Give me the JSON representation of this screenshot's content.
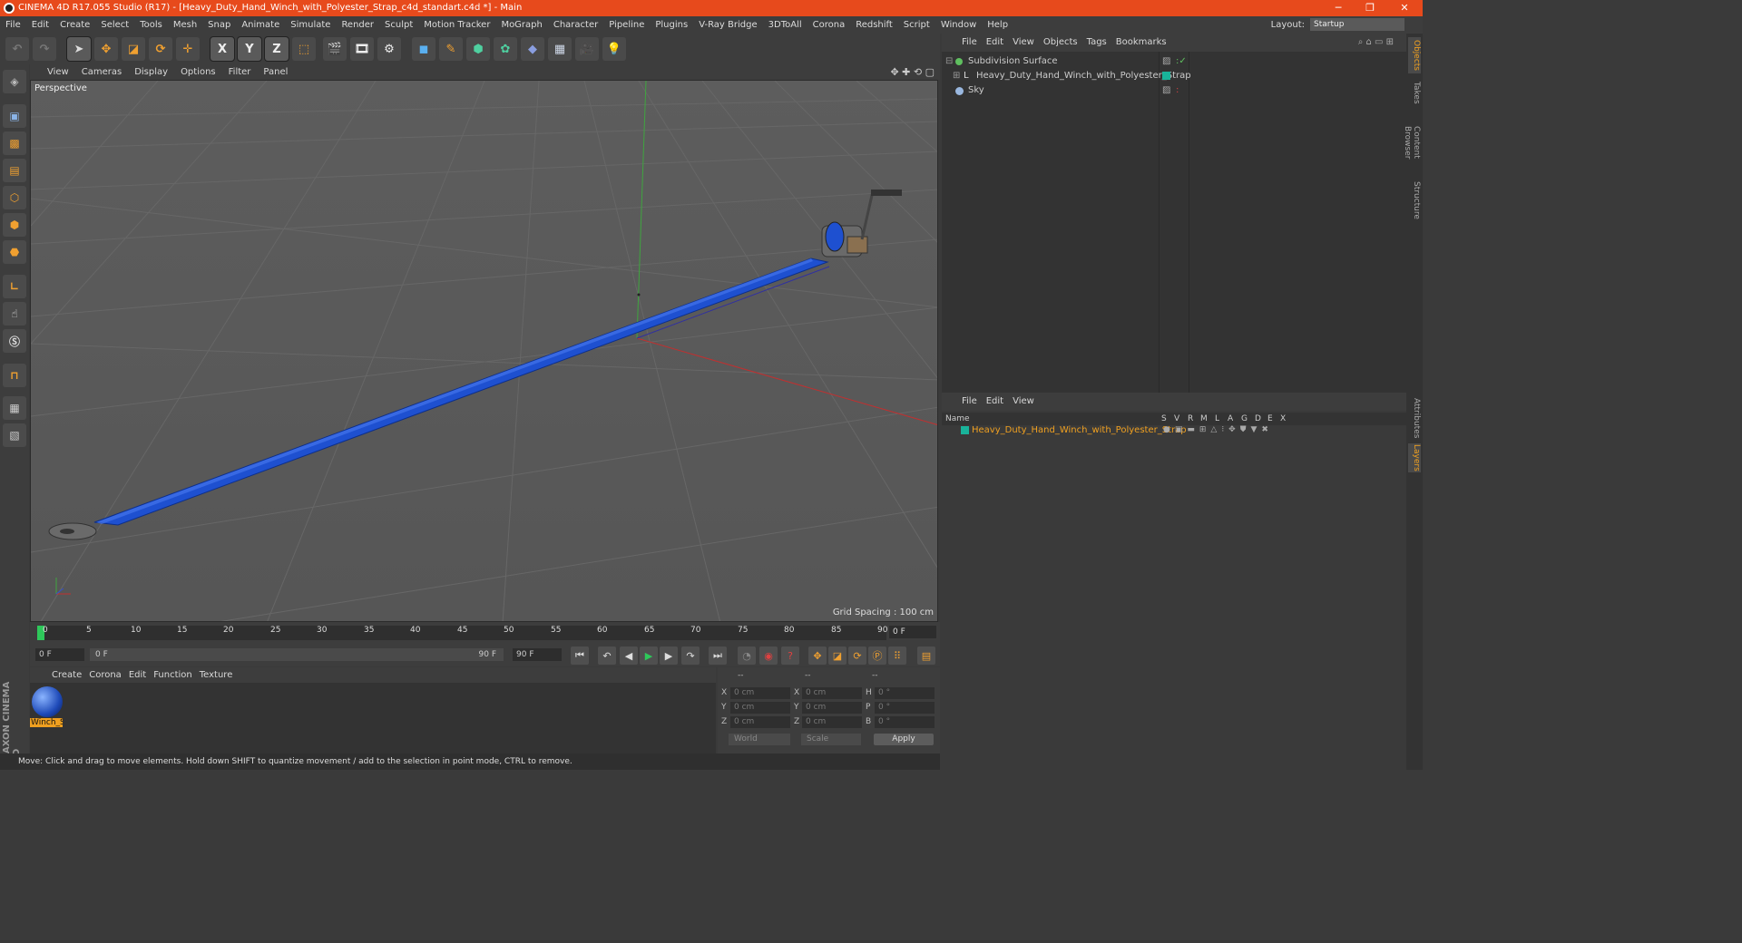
{
  "window": {
    "title": "CINEMA 4D R17.055 Studio (R17) - [Heavy_Duty_Hand_Winch_with_Polyester_Strap_c4d_standart.c4d *] - Main",
    "controls": [
      "─",
      "❐",
      "✕"
    ]
  },
  "menubar": {
    "items": [
      "File",
      "Edit",
      "Create",
      "Select",
      "Tools",
      "Mesh",
      "Snap",
      "Animate",
      "Simulate",
      "Render",
      "Sculpt",
      "Motion Tracker",
      "MoGraph",
      "Character",
      "Pipeline",
      "Plugins",
      "V-Ray Bridge",
      "3DToAll",
      "Corona",
      "Redshift",
      "Script",
      "Window",
      "Help"
    ],
    "layout_label": "Layout:",
    "layout_value": "Startup"
  },
  "toolbar": {
    "axis_x": "X",
    "axis_y": "Y",
    "axis_z": "Z"
  },
  "viewport": {
    "menu": [
      "View",
      "Cameras",
      "Display",
      "Options",
      "Filter",
      "Panel"
    ],
    "label": "Perspective",
    "grid_spacing": "Grid Spacing : 100 cm"
  },
  "timeline": {
    "ticks": [
      "0",
      "5",
      "10",
      "15",
      "20",
      "25",
      "30",
      "35",
      "40",
      "45",
      "50",
      "55",
      "60",
      "65",
      "70",
      "75",
      "80",
      "85",
      "90"
    ],
    "current_frame": "0 F",
    "start_field": "0 F",
    "range_start": "0 F",
    "range_end": "90 F",
    "end_field": "90 F"
  },
  "material_panel": {
    "menu": [
      "Create",
      "Corona",
      "Edit",
      "Function",
      "Texture"
    ],
    "material_name": "Winch_S"
  },
  "coord_panel": {
    "headers": [
      "--",
      "--",
      "--"
    ],
    "rows": [
      {
        "l1": "X",
        "v1": "0 cm",
        "l2": "X",
        "v2": "0 cm",
        "l3": "H",
        "v3": "0 °"
      },
      {
        "l1": "Y",
        "v1": "0 cm",
        "l2": "Y",
        "v2": "0 cm",
        "l3": "P",
        "v3": "0 °"
      },
      {
        "l1": "Z",
        "v1": "0 cm",
        "l2": "Z",
        "v2": "0 cm",
        "l3": "B",
        "v3": "0 °"
      }
    ],
    "world": "World",
    "scale": "Scale",
    "apply": "Apply"
  },
  "status_bar": "Move: Click and drag to move elements. Hold down SHIFT to quantize movement / add to the selection in point mode, CTRL to remove.",
  "object_panel": {
    "menu": [
      "File",
      "Edit",
      "View",
      "Objects",
      "Tags",
      "Bookmarks"
    ],
    "objects": [
      {
        "name": "Subdivision Surface",
        "color": "#5fbf5f"
      },
      {
        "name": "Heavy_Duty_Hand_Winch_with_Polyester_Strap",
        "color": "#e0e0e0"
      },
      {
        "name": "Sky",
        "color": "#9ab8e0"
      }
    ]
  },
  "layer_panel": {
    "menu": [
      "File",
      "Edit",
      "View"
    ],
    "header_name": "Name",
    "header_flags": [
      "S",
      "V",
      "R",
      "M",
      "L",
      "A",
      "G",
      "D",
      "E",
      "X"
    ],
    "layer_name": "Heavy_Duty_Hand_Winch_with_Polyester_Strap",
    "layer_color": "#19b39a"
  },
  "side_tabs": [
    "Objects",
    "Takes",
    "Content Browser",
    "Structure",
    "Attributes",
    "Layers"
  ],
  "colors": {
    "accent": "#e74a1c",
    "strap": "#1e50d0",
    "layer_text": "#f0a020"
  }
}
